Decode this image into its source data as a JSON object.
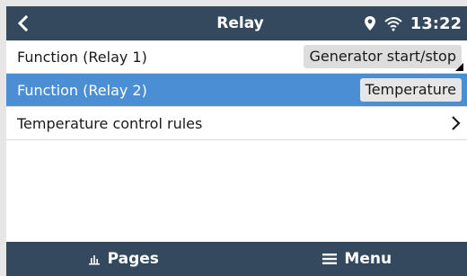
{
  "header": {
    "title": "Relay",
    "back_icon": "chevron-left-icon",
    "location_icon": "location-pin-icon",
    "wifi_icon": "wifi-icon",
    "time": "13:22"
  },
  "rows": [
    {
      "label": "Function (Relay 1)",
      "value": "Generator start/stop",
      "selected": false
    },
    {
      "label": "Function (Relay 2)",
      "value": "Temperature",
      "selected": true
    },
    {
      "label": "Temperature control rules",
      "value": "",
      "selected": false
    }
  ],
  "footer": {
    "pages_label": "Pages",
    "pages_icon": "pages-chart-icon",
    "menu_label": "Menu",
    "menu_icon": "hamburger-menu-icon"
  },
  "colors": {
    "header_bg": "#34495e",
    "selected_row_bg": "#4c8ed3",
    "value_box_bg": "#dddddd"
  }
}
